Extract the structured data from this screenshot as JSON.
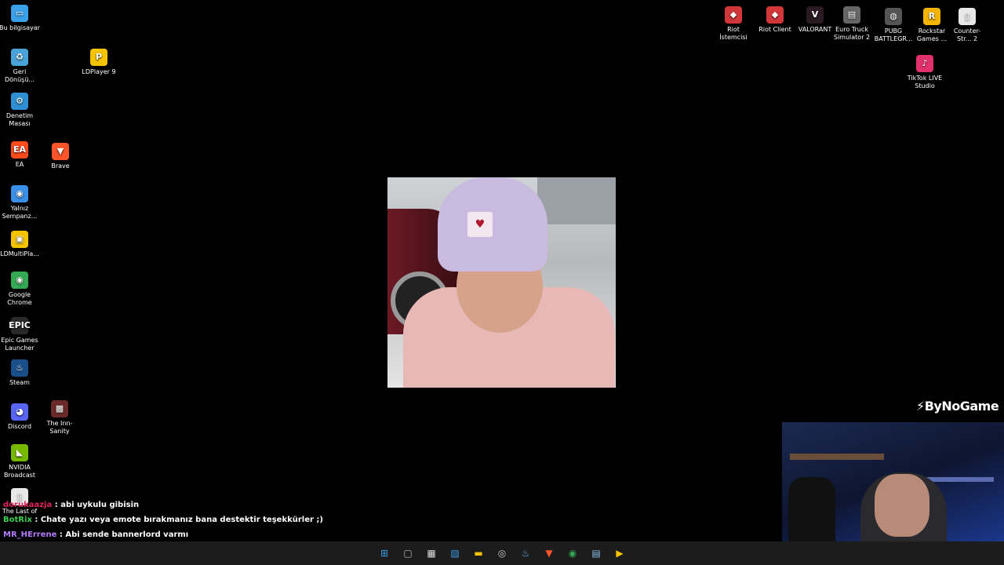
{
  "desktop_icons_left": [
    {
      "label": "Bu bilgisayar",
      "icon": "computer-icon",
      "color": "#3aa0e8",
      "glyph": "▭"
    },
    {
      "label": "Geri Dönüşü...",
      "icon": "recycle-bin-icon",
      "color": "#4aa3d8",
      "glyph": "♻"
    },
    {
      "label": "Denetim Masası",
      "icon": "control-panel-icon",
      "color": "#2f8fd0",
      "glyph": "⚙"
    },
    {
      "label": "EA",
      "icon": "ea-icon",
      "color": "#ff4a1c",
      "glyph": "EA"
    },
    {
      "label": "Yalnız Sempanz...",
      "icon": "chrome-icon",
      "color": "#3a8ee6",
      "glyph": "◉"
    },
    {
      "label": "LDMultiPla...",
      "icon": "ldmultiplayer-icon",
      "color": "#f5c400",
      "glyph": "▣"
    },
    {
      "label": "Google Chrome",
      "icon": "chrome-icon",
      "color": "#34a853",
      "glyph": "◉"
    },
    {
      "label": "Epic Games Launcher",
      "icon": "epic-games-icon",
      "color": "#2a2a2a",
      "glyph": "EPIC"
    },
    {
      "label": "Steam",
      "icon": "steam-icon",
      "color": "#1b4f8a",
      "glyph": "♨"
    },
    {
      "label": "Discord",
      "icon": "discord-icon",
      "color": "#5865f2",
      "glyph": "◕"
    },
    {
      "label": "NVIDIA Broadcast",
      "icon": "nvidia-icon",
      "color": "#76b900",
      "glyph": "◣"
    },
    {
      "label": "The Last of",
      "icon": "file-icon",
      "color": "#e8e8e8",
      "glyph": "▯"
    }
  ],
  "desktop_icons_col2": [
    {
      "label": "LDPlayer 9",
      "icon": "ldplayer-icon",
      "color": "#f5c400",
      "glyph": "P"
    },
    {
      "label": "Brave",
      "icon": "brave-icon",
      "color": "#fb542b",
      "glyph": "▼"
    },
    {
      "label": "The Inn-Sanity",
      "icon": "game-icon",
      "color": "#6b2a2a",
      "glyph": "▩"
    }
  ],
  "desktop_icons_right": [
    {
      "label": "Riot İstemcisi",
      "icon": "riot-icon",
      "color": "#d13639",
      "glyph": "◆"
    },
    {
      "label": "Riot Client",
      "icon": "riot-icon",
      "color": "#d13639",
      "glyph": "◆"
    },
    {
      "label": "VALORANT",
      "icon": "valorant-icon",
      "color": "#2a1a22",
      "glyph": "V"
    },
    {
      "label": "Euro Truck Simulator 2",
      "icon": "truck-icon",
      "color": "#666",
      "glyph": "▤"
    },
    {
      "label": "PUBG BATTLEGR...",
      "icon": "pubg-icon",
      "color": "#555",
      "glyph": "◍"
    },
    {
      "label": "Rockstar Games ...",
      "icon": "rockstar-icon",
      "color": "#f5b400",
      "glyph": "R"
    },
    {
      "label": "Counter-Str... 2",
      "icon": "file-icon",
      "color": "#e8e8e8",
      "glyph": "▯"
    },
    {
      "label": "TikTok LIVE Studio",
      "icon": "tiktok-icon",
      "color": "#e1306c",
      "glyph": "♪"
    }
  ],
  "brand": "ByNoGame",
  "chat": [
    {
      "user": "dorukaazja",
      "message": " : abi uykulu gibisin"
    },
    {
      "user": "BotRix",
      "message": " : Chate yazı veya emote bırakmanız bana destektir teşekkürler ;)"
    },
    {
      "user": "MR_HErrene",
      "message": " : Abi sende bannerlord varmı"
    }
  ],
  "taskbar": [
    {
      "name": "start-icon",
      "glyph": "⊞",
      "color": "#3aa0e8"
    },
    {
      "name": "task-view-icon",
      "glyph": "▢",
      "color": "#bbb"
    },
    {
      "name": "app-icon",
      "glyph": "▦",
      "color": "#ddd"
    },
    {
      "name": "photos-icon",
      "glyph": "▨",
      "color": "#3a9ee8"
    },
    {
      "name": "file-explorer-icon",
      "glyph": "▬",
      "color": "#f5c400"
    },
    {
      "name": "obs-icon",
      "glyph": "◎",
      "color": "#ccc"
    },
    {
      "name": "steam-icon",
      "glyph": "♨",
      "color": "#6fb3ee"
    },
    {
      "name": "brave-icon",
      "glyph": "▼",
      "color": "#fb542b"
    },
    {
      "name": "chrome-icon",
      "glyph": "◉",
      "color": "#34a853"
    },
    {
      "name": "notepad-icon",
      "glyph": "▤",
      "color": "#8bc4f0"
    },
    {
      "name": "media-icon",
      "glyph": "▶",
      "color": "#f5c400"
    }
  ]
}
